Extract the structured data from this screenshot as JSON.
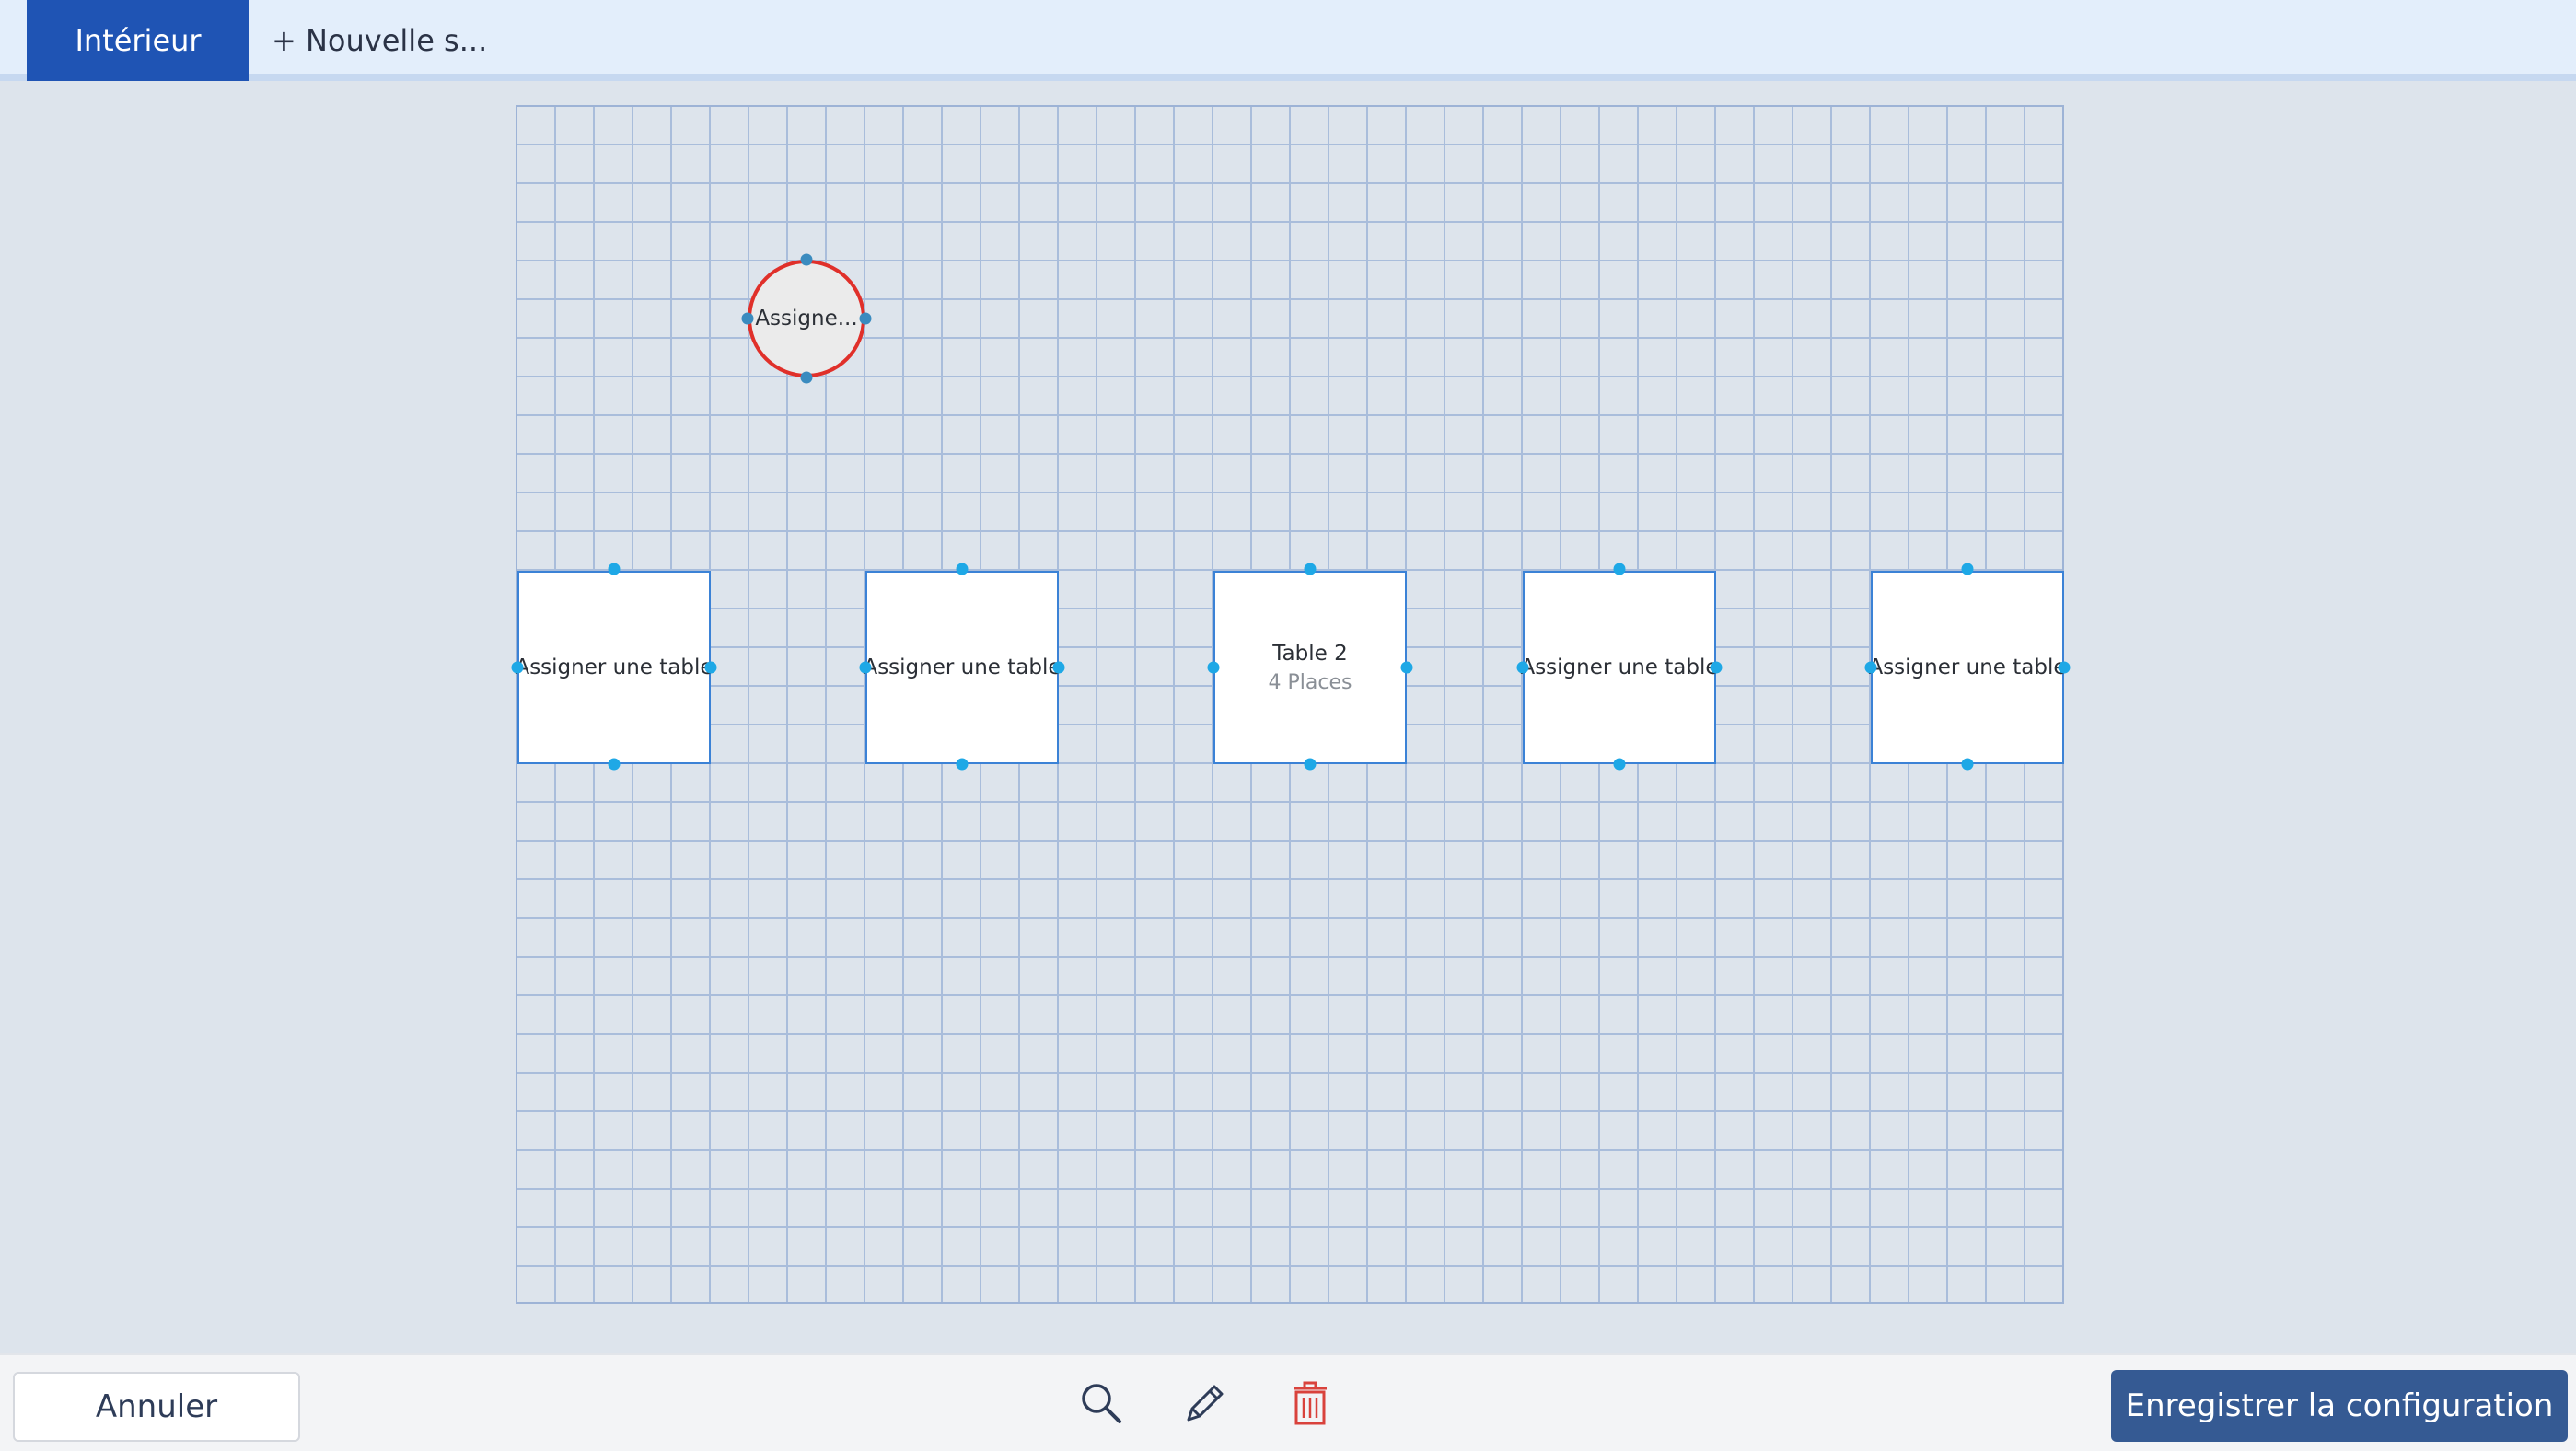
{
  "header": {
    "tabs": [
      {
        "label": "Intérieur",
        "active": true
      },
      {
        "label": "+ Nouvelle s..."
      }
    ]
  },
  "floor": {
    "tables": [
      {
        "shape": "round",
        "label": "Assigne...",
        "selected": true
      },
      {
        "shape": "square",
        "label": "Assigner une table"
      },
      {
        "shape": "square",
        "label": "Assigner une table"
      },
      {
        "shape": "square",
        "label": "Table 2",
        "sublabel": "4 Places"
      },
      {
        "shape": "square",
        "label": "Assigner une table"
      },
      {
        "shape": "square",
        "label": "Assigner une table"
      }
    ]
  },
  "footer": {
    "cancel_label": "Annuler",
    "save_label": "Enregistrer la configuration",
    "tools": [
      "search-icon",
      "pencil-icon",
      "trash-icon"
    ]
  },
  "colors": {
    "accent": "#1f54b4",
    "save_button": "#355a93",
    "selection_red": "#e0302a",
    "handle_blue": "#1ea8e6",
    "delete_red": "#d9423c"
  }
}
